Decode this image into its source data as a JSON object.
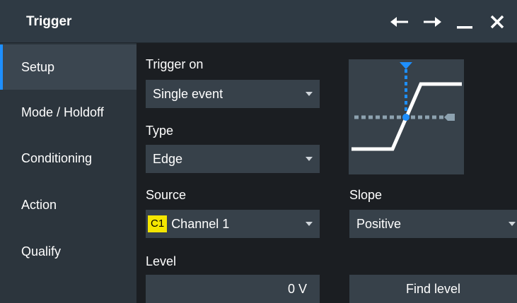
{
  "window": {
    "title": "Trigger"
  },
  "sidebar": {
    "items": [
      {
        "label": "Setup",
        "active": true
      },
      {
        "label": "Mode / Holdoff"
      },
      {
        "label": "Conditioning"
      },
      {
        "label": "Action"
      },
      {
        "label": "Qualify"
      }
    ]
  },
  "setup": {
    "trigger_on": {
      "label": "Trigger on",
      "value": "Single event"
    },
    "type": {
      "label": "Type",
      "value": "Edge"
    },
    "source": {
      "label": "Source",
      "chip": "C1",
      "value": "Channel 1",
      "chip_color": "#f4e600"
    },
    "slope": {
      "label": "Slope",
      "value": "Positive"
    },
    "level": {
      "label": "Level",
      "value": "0 V"
    },
    "find_level_button": "Find level"
  },
  "colors": {
    "accent": "#1e8fff",
    "panel": "#37414a",
    "sidebar": "#2c353d"
  },
  "icons": [
    "arrow-left-icon",
    "arrow-right-icon",
    "minimize-icon",
    "close-icon",
    "dropdown-caret-icon",
    "edge-trigger-preview-icon"
  ]
}
